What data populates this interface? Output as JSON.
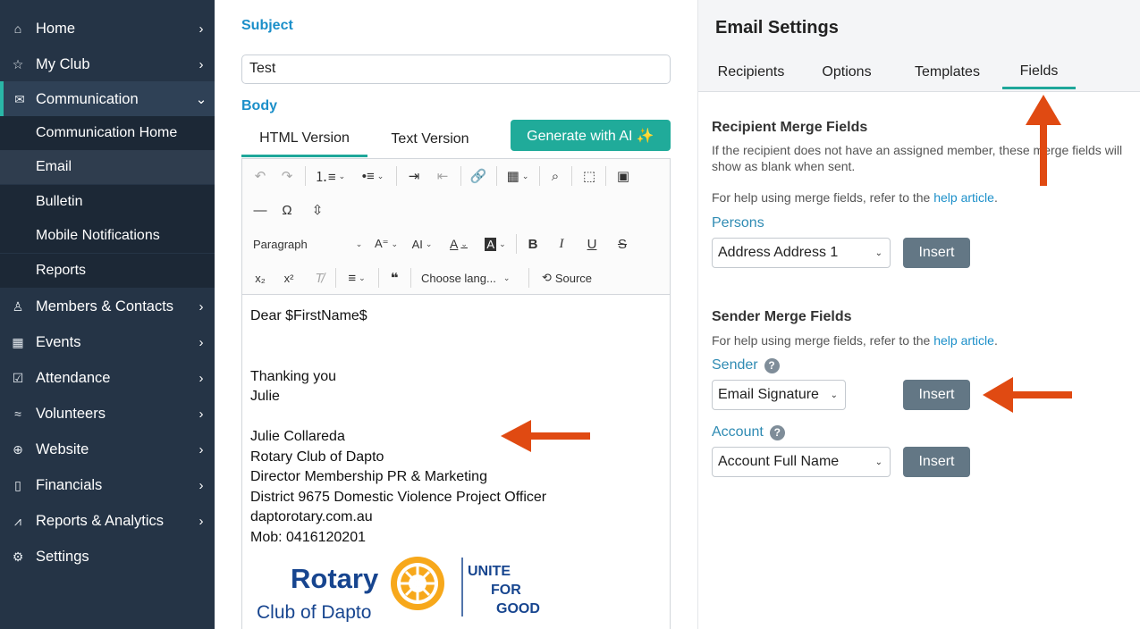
{
  "sidebar": {
    "items": [
      {
        "label": "Home",
        "icon": "home-icon"
      },
      {
        "label": "My Club",
        "icon": "star-icon"
      },
      {
        "label": "Communication",
        "icon": "mail-icon"
      },
      {
        "label": "Members & Contacts",
        "icon": "person-icon"
      },
      {
        "label": "Events",
        "icon": "calendar-icon"
      },
      {
        "label": "Attendance",
        "icon": "checkbox-icon"
      },
      {
        "label": "Volunteers",
        "icon": "handshake-icon"
      },
      {
        "label": "Website",
        "icon": "globe-icon"
      },
      {
        "label": "Financials",
        "icon": "document-icon"
      },
      {
        "label": "Reports & Analytics",
        "icon": "chart-icon"
      },
      {
        "label": "Settings",
        "icon": "gear-icon"
      }
    ],
    "submenu": [
      "Communication Home",
      "Email",
      "Bulletin",
      "Mobile Notifications",
      "Reports"
    ]
  },
  "editor": {
    "subject_label": "Subject",
    "subject_value": "Test",
    "body_label": "Body",
    "tabs": [
      "HTML Version",
      "Text Version"
    ],
    "ai_button": "Generate with AI ✨",
    "toolbar": {
      "paragraph": "Paragraph",
      "language": "Choose lang...",
      "source": "Source"
    },
    "body_lines": [
      "Dear $FirstName$",
      "",
      "",
      "Thanking you",
      "Julie",
      "",
      "Julie Collareda",
      "Rotary Club of Dapto",
      "Director Membership PR & Marketing",
      "District 9675 Domestic Violence Project Officer",
      "daptorotary.com.au",
      "Mob: 0416120201"
    ],
    "logo": {
      "rotary": "Rotary",
      "club": "Club of Dapto",
      "slogan1": "UNITE",
      "slogan2": "FOR",
      "slogan3": "GOOD"
    }
  },
  "settings": {
    "title": "Email Settings",
    "tabs": [
      "Recipients",
      "Options",
      "Templates",
      "Fields"
    ],
    "recipient_title": "Recipient Merge Fields",
    "recipient_help": "If the recipient does not have an assigned member, these merge fields will show as blank when sent.",
    "help_prefix": "For help using merge fields, refer to the ",
    "help_link": "help article",
    "help_suffix": ".",
    "persons_label": "Persons",
    "persons_value": "Address Address 1",
    "insert_label": "Insert",
    "sender_title": "Sender Merge Fields",
    "sender_label": "Sender",
    "sender_value": "Email Signature",
    "account_label": "Account",
    "account_value": "Account Full Name"
  },
  "colors": {
    "sidebar": "#253446",
    "accent_teal": "#20ab9a",
    "link_blue": "#1b8fc9",
    "annotation_arrow": "#e04a12"
  }
}
